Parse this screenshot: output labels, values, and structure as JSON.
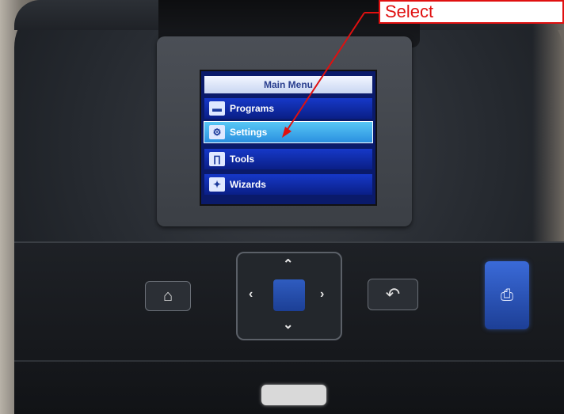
{
  "annotation": {
    "label": "Select",
    "color": "#e01010"
  },
  "display": {
    "title": "Main Menu",
    "menu_items": [
      {
        "label": "Programs",
        "icon": "folder-icon",
        "selected": false
      },
      {
        "label": "Settings",
        "icon": "gears-icon",
        "selected": true
      },
      {
        "label": "Tools",
        "icon": "tools-icon",
        "selected": false
      },
      {
        "label": "Wizards",
        "icon": "wizard-icon",
        "selected": false
      }
    ]
  },
  "controls": {
    "home_icon": "home-icon",
    "dpad_icons": [
      "up-arrow-icon",
      "down-arrow-icon",
      "left-arrow-icon",
      "right-arrow-icon"
    ],
    "select_color": "#2f5cc0",
    "back_icon": "back-icon",
    "feed_icon": "feed-icon"
  }
}
